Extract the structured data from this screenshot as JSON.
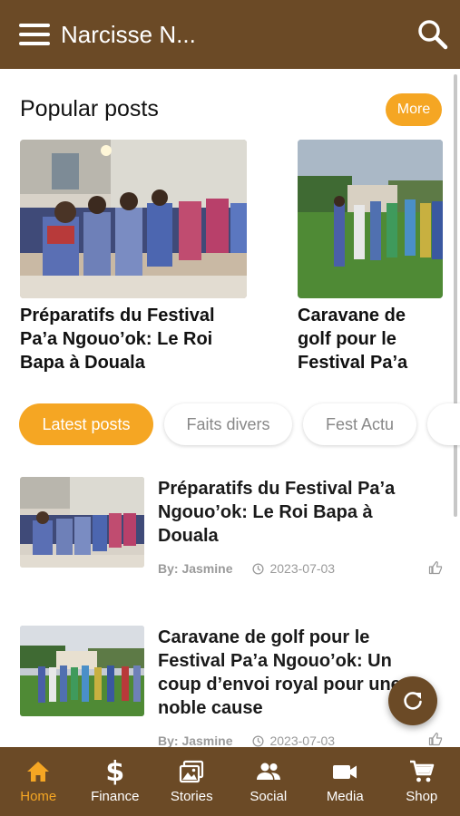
{
  "header": {
    "title": "Narcisse N..."
  },
  "popular": {
    "title": "Popular posts",
    "more_label": "More",
    "cards": [
      {
        "title": "Préparatifs du Festival Pa’a Ngouo’ok: Le Roi Bapa à Douala"
      },
      {
        "title": "Caravane de golf pour le Festival Pa’a Ngouo’ok: Un coup d’envoi royal pour une noble cause"
      }
    ]
  },
  "categories": [
    "Latest posts",
    "Faits divers",
    "Fest Actu",
    ""
  ],
  "posts": [
    {
      "title": "Préparatifs du Festival Pa’a Ngouo’ok: Le Roi Bapa à Douala",
      "author": "By: Jasmine",
      "date": "2023-07-03"
    },
    {
      "title": "Caravane de golf pour le Festival Pa’a Ngouo’ok: Un coup d’envoi royal pour une noble cause",
      "author": "By: Jasmine",
      "date": "2023-07-03"
    }
  ],
  "nav": [
    {
      "label": "Home",
      "icon": "home-icon",
      "active": true
    },
    {
      "label": "Finance",
      "icon": "dollar-icon"
    },
    {
      "label": "Stories",
      "icon": "photos-icon"
    },
    {
      "label": "Social",
      "icon": "people-icon"
    },
    {
      "label": "Media",
      "icon": "video-camera-icon"
    },
    {
      "label": "Shop",
      "icon": "cart-icon"
    }
  ],
  "colors": {
    "brand": "#6b4a26",
    "accent": "#f5a623"
  }
}
